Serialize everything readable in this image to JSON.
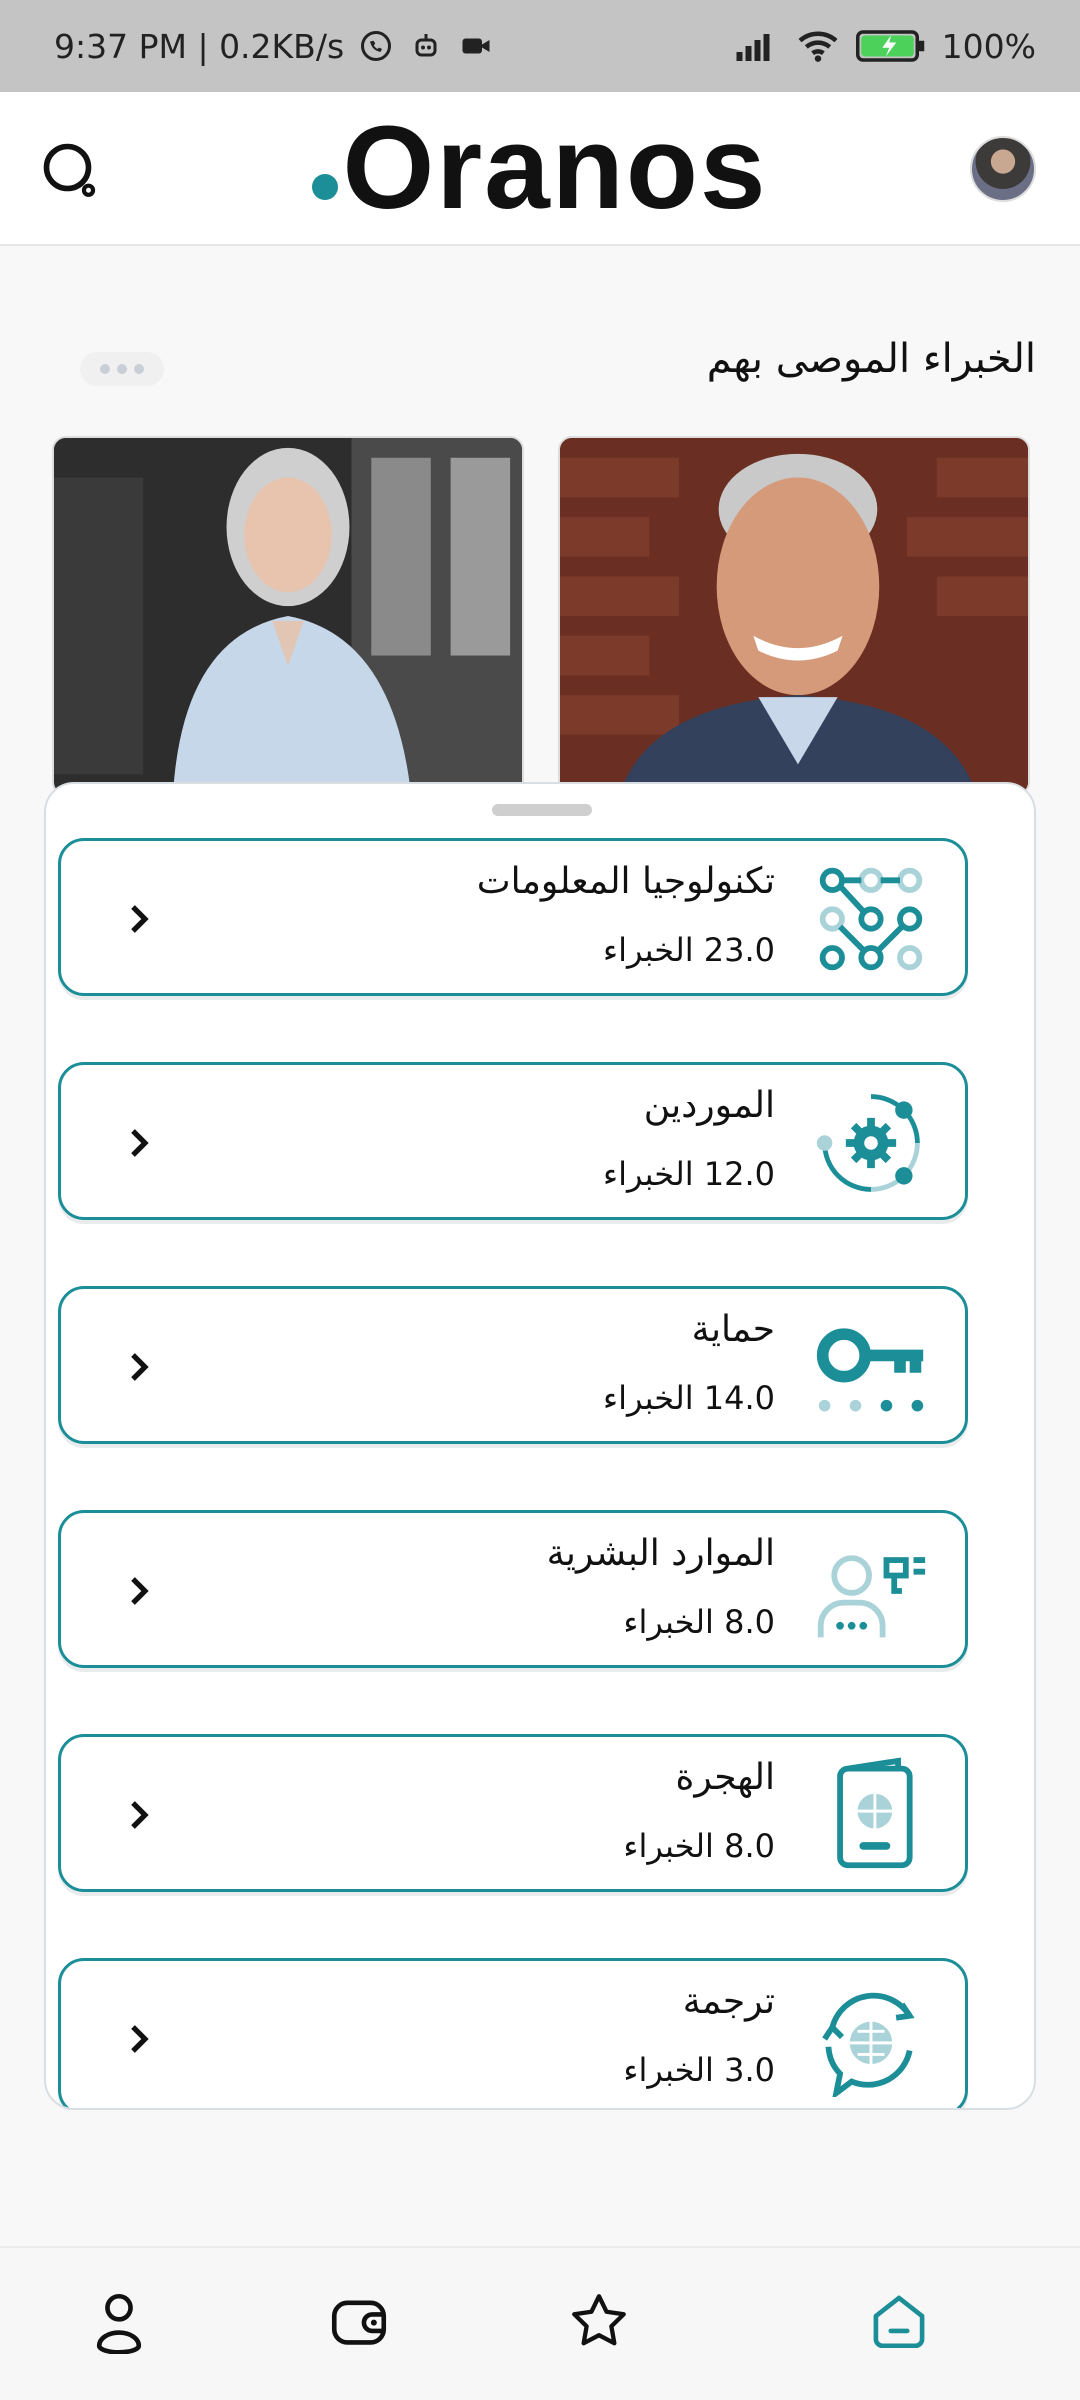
{
  "status_bar": {
    "time_speed": "9:37 PM | 0.2KB/s",
    "battery": "100%"
  },
  "header": {
    "logo": "Oranos",
    "search_icon": "search-icon",
    "avatar": "user-avatar"
  },
  "recommended": {
    "title": "الخبراء الموصى بهم",
    "more_icon": "more-dots-icon"
  },
  "categories": [
    {
      "title": "تكنولوجيا المعلومات",
      "count": "23.0 الخبراء",
      "icon": "network-nodes-icon"
    },
    {
      "title": "الموردين",
      "count": "12.0 الخبراء",
      "icon": "gear-orbit-icon"
    },
    {
      "title": "حماية",
      "count": "14.0 الخبراء",
      "icon": "key-icon"
    },
    {
      "title": "الموارد البشرية",
      "count": "8.0 الخبراء",
      "icon": "person-chat-icon"
    },
    {
      "title": "الهجرة",
      "count": "8.0 الخبراء",
      "icon": "passport-icon"
    },
    {
      "title": "ترجمة",
      "count": "3.0 الخبراء",
      "icon": "globe-translate-icon"
    }
  ],
  "bottom_nav": [
    "profile-icon",
    "wallet-icon",
    "star-icon",
    "home-icon"
  ],
  "colors": {
    "accent": "#1c8e98",
    "accent_light": "#a9d3d8"
  }
}
